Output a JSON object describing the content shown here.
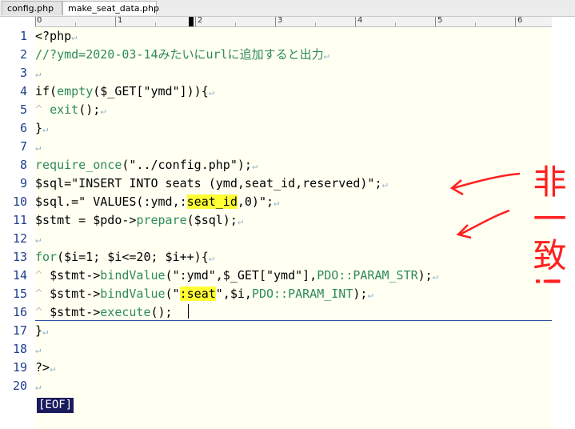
{
  "tabs": [
    {
      "label": "config.php"
    },
    {
      "label": "make_seat_data.php"
    }
  ],
  "ruler": {
    "marks": [
      "0",
      "1",
      "2",
      "3",
      "4",
      "5",
      "6"
    ]
  },
  "line_numbers": [
    "1",
    "2",
    "3",
    "4",
    "5",
    "6",
    "7",
    "8",
    "9",
    "10",
    "11",
    "12",
    "13",
    "14",
    "15",
    "16",
    "17",
    "18",
    "19",
    "20"
  ],
  "code": {
    "l1": "<?php",
    "l2": "//?ymd=2020-03-14みたいにurlに追加すると出力",
    "l4a": "if(",
    "l4b": "empty",
    "l4c": "($_GET[\"ymd\"])){",
    "l5a": "exit",
    "l5b": "();",
    "l6": "}",
    "l8a": "require_once",
    "l8b": "(\"../config.php\");",
    "l9": "$sql=\"INSERT INTO seats (ymd,seat_id,reserved)\";",
    "l10a": "$sql.=\" VALUES(:ymd,:",
    "l10b": "seat_id",
    "l10c": ",0)\";",
    "l11a": "$stmt = $pdo->",
    "l11b": "prepare",
    "l11c": "($sql);",
    "l13a": "for",
    "l13b": "($i=1; $i<=20; $i++){",
    "l14a": "$stmt->",
    "l14b": "bindValue",
    "l14c": "(\":ymd\",$_GET[\"ymd\"],",
    "l14d": "PDO::PARAM_STR",
    "l14e": ");",
    "l15a": "$stmt->",
    "l15b": "bindValue",
    "l15c": "(\"",
    "l15d": ":seat",
    "l15e": "\",$i,",
    "l15f": "PDO::PARAM_INT",
    "l15g": ");",
    "l16a": "$stmt->",
    "l16b": "execute",
    "l16c": "();",
    "l17": "}",
    "l19": "?>"
  },
  "eof_label": "[EOF]",
  "annotation": {
    "text": "非一致!"
  }
}
